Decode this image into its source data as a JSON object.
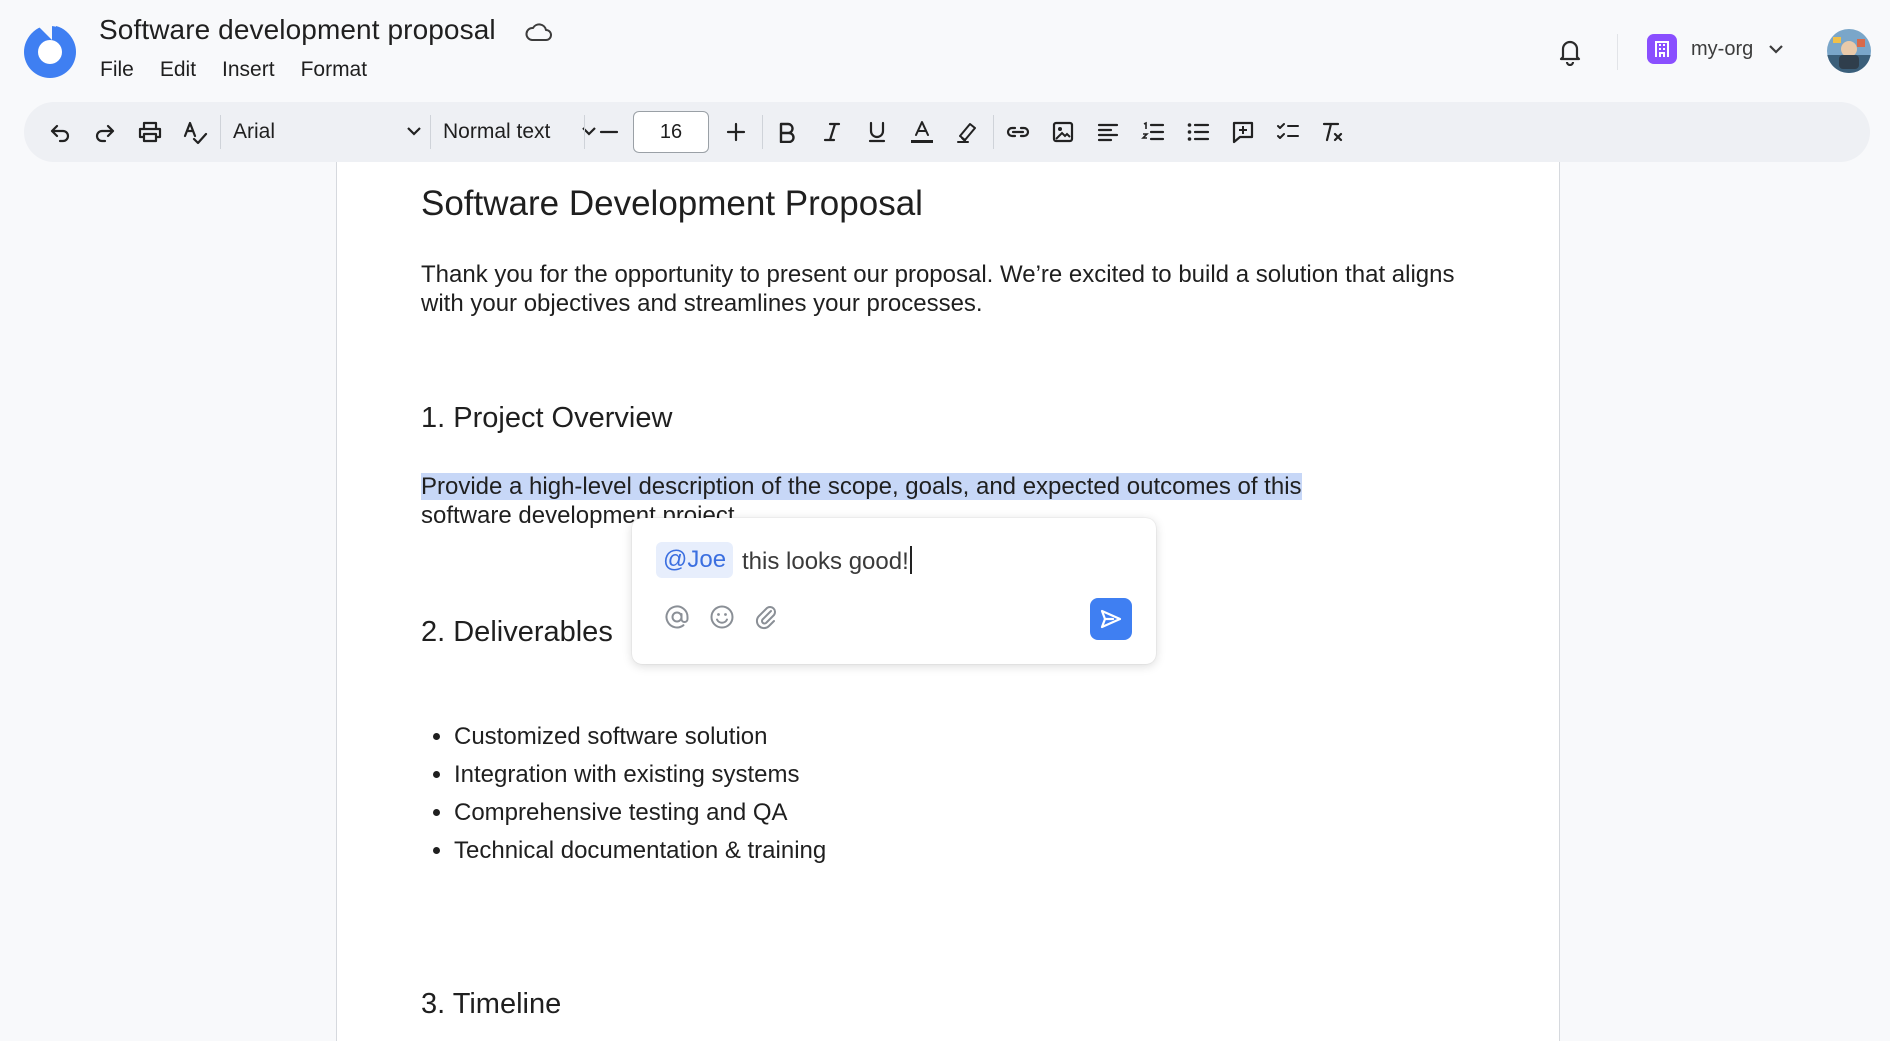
{
  "header": {
    "title": "Software development proposal",
    "menu": [
      "File",
      "Edit",
      "Insert",
      "Format"
    ],
    "org_name": "my-org"
  },
  "toolbar": {
    "font": "Arial",
    "text_style": "Normal text",
    "font_size": "16"
  },
  "document": {
    "title": "Software Development Proposal",
    "intro": "Thank you for the opportunity to present our proposal. We’re excited to build a solution that aligns with your objectives and streamlines your processes.",
    "section1": {
      "heading": "1. Project Overview",
      "body_highlighted": "Provide a high-level description of the scope, goals, and expected outcomes of this",
      "body_rest": "software development project."
    },
    "section2": {
      "heading": "2. Deliverables",
      "items": [
        "Customized software solution",
        "Integration with existing systems",
        "Comprehensive testing and QA",
        "Technical documentation & training"
      ]
    },
    "section3": {
      "heading": "3. Timeline"
    }
  },
  "comment": {
    "mention": "@Joe",
    "text": "this looks good!"
  },
  "colors": {
    "accent": "#3f7ff2",
    "highlight": "#c7d7f7",
    "org_badge": "#8a4fff"
  },
  "icons": [
    "logo",
    "cloud-icon",
    "bell-icon",
    "org-icon",
    "chevron-down-icon",
    "undo-icon",
    "redo-icon",
    "print-icon",
    "spellcheck-icon",
    "minus-icon",
    "plus-icon",
    "bold-icon",
    "italic-icon",
    "underline-icon",
    "text-color-icon",
    "highlight-icon",
    "link-icon",
    "image-icon",
    "align-left-icon",
    "numbered-list-icon",
    "bulleted-list-icon",
    "add-comment-icon",
    "checklist-icon",
    "clear-format-icon",
    "at-icon",
    "emoji-icon",
    "attach-icon",
    "send-icon"
  ]
}
